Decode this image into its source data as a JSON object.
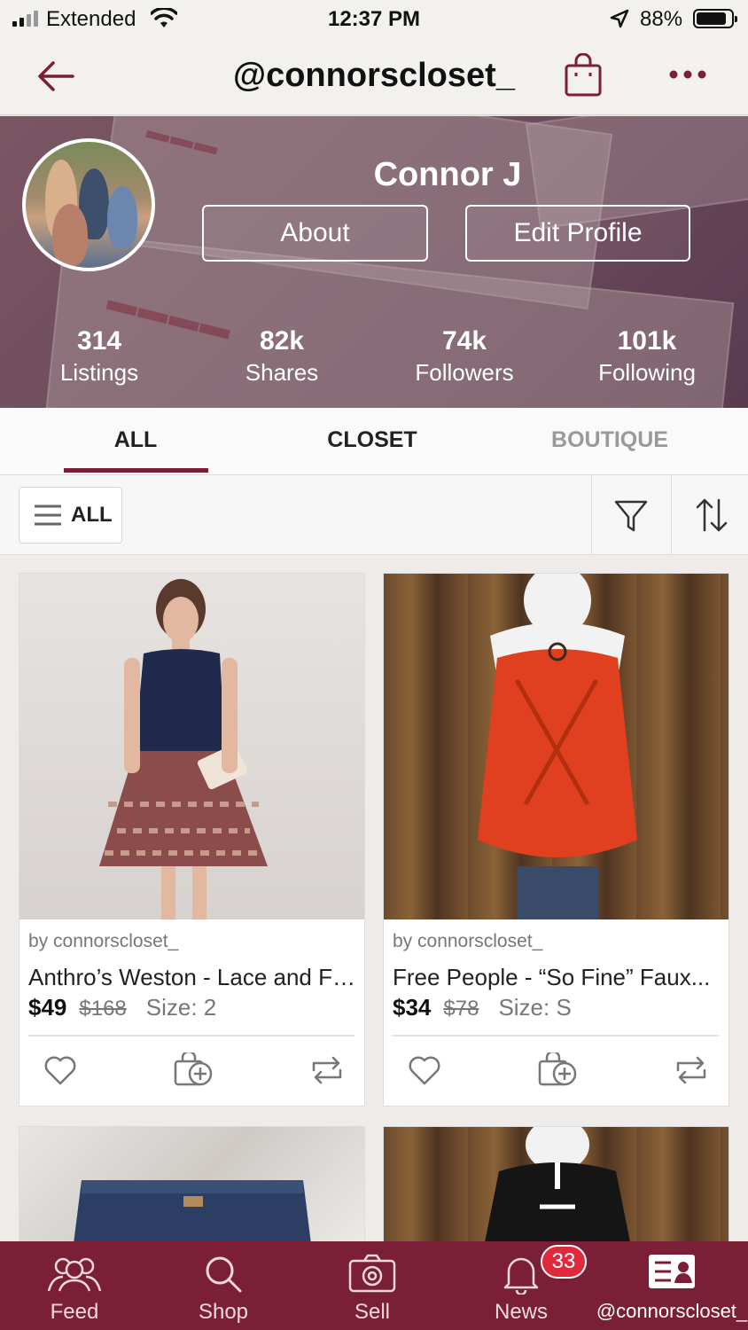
{
  "status_bar": {
    "carrier": "Extended",
    "time": "12:37 PM",
    "battery": "88%",
    "battery_level": 0.88
  },
  "nav": {
    "title": "@connorscloset_",
    "back_icon": "arrow-left-icon",
    "bag_icon": "shopping-bag-icon",
    "more_icon": "more-dots-icon"
  },
  "profile": {
    "name": "Connor J",
    "about_label": "About",
    "edit_label": "Edit Profile",
    "stats": [
      {
        "value": "314",
        "label": "Listings"
      },
      {
        "value": "82k",
        "label": "Shares"
      },
      {
        "value": "74k",
        "label": "Followers"
      },
      {
        "value": "101k",
        "label": "Following"
      }
    ]
  },
  "tabs": [
    {
      "label": "ALL",
      "active": true
    },
    {
      "label": "CLOSET",
      "active": false
    },
    {
      "label": "BOUTIQUE",
      "active": false
    }
  ],
  "filter": {
    "all_label": "ALL"
  },
  "listings": [
    {
      "by": "by connorscloset_",
      "title": "Anthro’s Weston - Lace and Fl...",
      "price": "$49",
      "original_price": "$168",
      "size": "Size: 2"
    },
    {
      "by": "by connorscloset_",
      "title": "Free People - “So Fine” Faux...",
      "price": "$34",
      "original_price": "$78",
      "size": "Size: S"
    }
  ],
  "bottom_nav": [
    {
      "label": "Feed",
      "icon": "people-icon"
    },
    {
      "label": "Shop",
      "icon": "search-icon"
    },
    {
      "label": "Sell",
      "icon": "camera-icon"
    },
    {
      "label": "News",
      "icon": "bell-icon"
    },
    {
      "label": "@connorscloset_",
      "icon": "profile-card-icon"
    }
  ],
  "news_badge": "33",
  "colors": {
    "brand": "#7a1f35",
    "badge": "#e02a3c"
  }
}
